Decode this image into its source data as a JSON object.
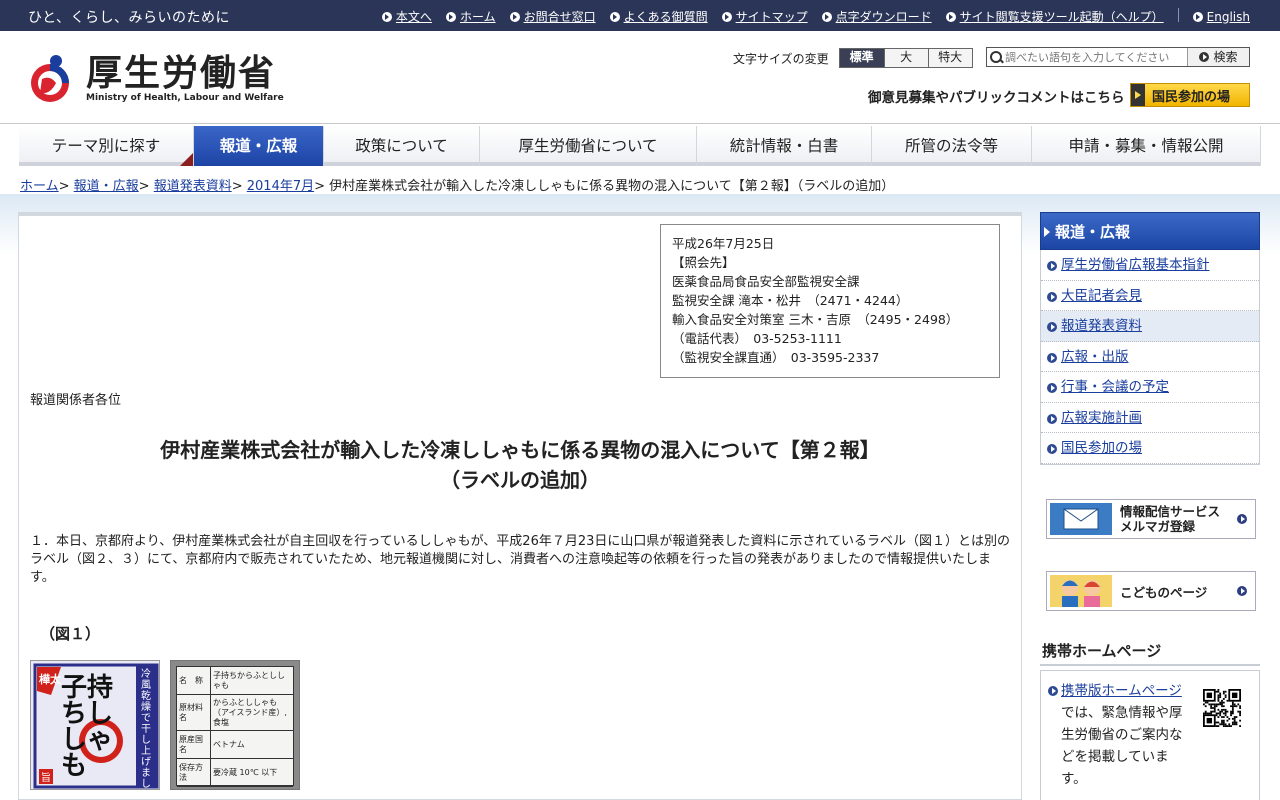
{
  "topbar": {
    "tagline": "ひと、くらし、みらいのために",
    "links": [
      {
        "label": "本文へ",
        "icon": "arrow-circle-icon"
      },
      {
        "label": "ホーム",
        "icon": "home-icon"
      },
      {
        "label": "お問合せ窓口",
        "icon": "arrow-circle-icon"
      },
      {
        "label": "よくある御質問",
        "icon": "arrow-circle-icon"
      },
      {
        "label": "サイトマップ",
        "icon": "arrow-circle-icon"
      },
      {
        "label": "点字ダウンロード",
        "icon": "arrow-circle-icon"
      },
      {
        "label": "サイト閲覧支援ツール起動（ヘルプ）",
        "icon": "arrow-circle-icon"
      },
      {
        "label": "English",
        "icon": "arrow-circle-icon"
      }
    ]
  },
  "header": {
    "logo_jp": "厚生労働省",
    "logo_en": "Ministry of Health, Labour and Welfare",
    "fontsize_label": "文字サイズの変更",
    "fontsize_options": [
      "標準",
      "大",
      "特大"
    ],
    "search_placeholder": "調べたい語句を入力してください",
    "search_button": "検索",
    "pubcomment": "御意見募集やパブリックコメントはこちら",
    "kokumin_button": "国民参加の場"
  },
  "nav": {
    "items": [
      {
        "label": "テーマ別に探す",
        "width": 175
      },
      {
        "label": "報道・広報",
        "width": 130
      },
      {
        "label": "政策について",
        "width": 156
      },
      {
        "label": "厚生労働省について",
        "width": 217
      },
      {
        "label": "統計情報・白書",
        "width": 175
      },
      {
        "label": "所管の法令等",
        "width": 160
      },
      {
        "label": "申請・募集・情報公開",
        "width": 229
      }
    ]
  },
  "breadcrumb": {
    "links": [
      "ホーム",
      "報道・広報",
      "報道発表資料",
      "2014年7月"
    ],
    "current": "伊村産業株式会社が輸入した冷凍ししゃもに係る異物の混入について【第２報】（ラベルの追加）"
  },
  "infobox": {
    "text": "平成26年7月25日\n【照会先】\n医薬食品局食品安全部監視安全課\n監視安全課 滝本・松井　（2471・4244）\n輸入食品安全対策室 三木・吉原　（2495・2498）\n（電話代表）　03-5253-1111\n（監視安全課直通）　03-3595-2337"
  },
  "article": {
    "addressee": "報道関係者各位",
    "title_line1": "伊村産業株式会社が輸入した冷凍ししゃもに係る異物の混入について【第２報】",
    "title_line2": "（ラベルの追加）",
    "body1": "１．本日、京都府より、伊村産業株式会社が自主回収を行っているししゃもが、平成26年７月23日に山口県が報道発表した資料に示されているラベル（図１）とは別のラベル（図２、３）にて、京都府内で販売されていたため、地元報道機関に対し、消費者への注意喚起等の依頼を行った旨の発表がありましたので情報提供いたします。",
    "fig1_label": "（図１）",
    "label1": {
      "vertical_right": "冷風乾燥で干し上げました",
      "badge": "樺太",
      "main": "子持ちししゃも",
      "corner": "旨"
    },
    "label2": {
      "rows": [
        {
          "k": "名　称",
          "v": "子持ちからふとししゃも"
        },
        {
          "k": "原材料名",
          "v": "からふとししゃも（アイスランド産）,食塩"
        },
        {
          "k": "原産国名",
          "v": "ベトナム"
        },
        {
          "k": "保存方法",
          "v": "要冷蔵 10℃ 以下"
        }
      ]
    }
  },
  "sidebar": {
    "heading": "報道・広報",
    "items": [
      "厚生労働省広報基本指針",
      "大臣記者会見",
      "報道発表資料",
      "広報・出版",
      "行事・会議の予定",
      "広報実施計画",
      "国民参加の場"
    ],
    "current_index": 2,
    "banner_mail": [
      "情報配信サービス",
      "メルマガ登録"
    ],
    "banner_kids": "こどものページ",
    "mobile_heading": "携帯ホームページ",
    "mobile_link": "携帯版ホームページ",
    "mobile_text": "では、緊急情報や厚生労働省のご案内などを掲載しています。"
  }
}
